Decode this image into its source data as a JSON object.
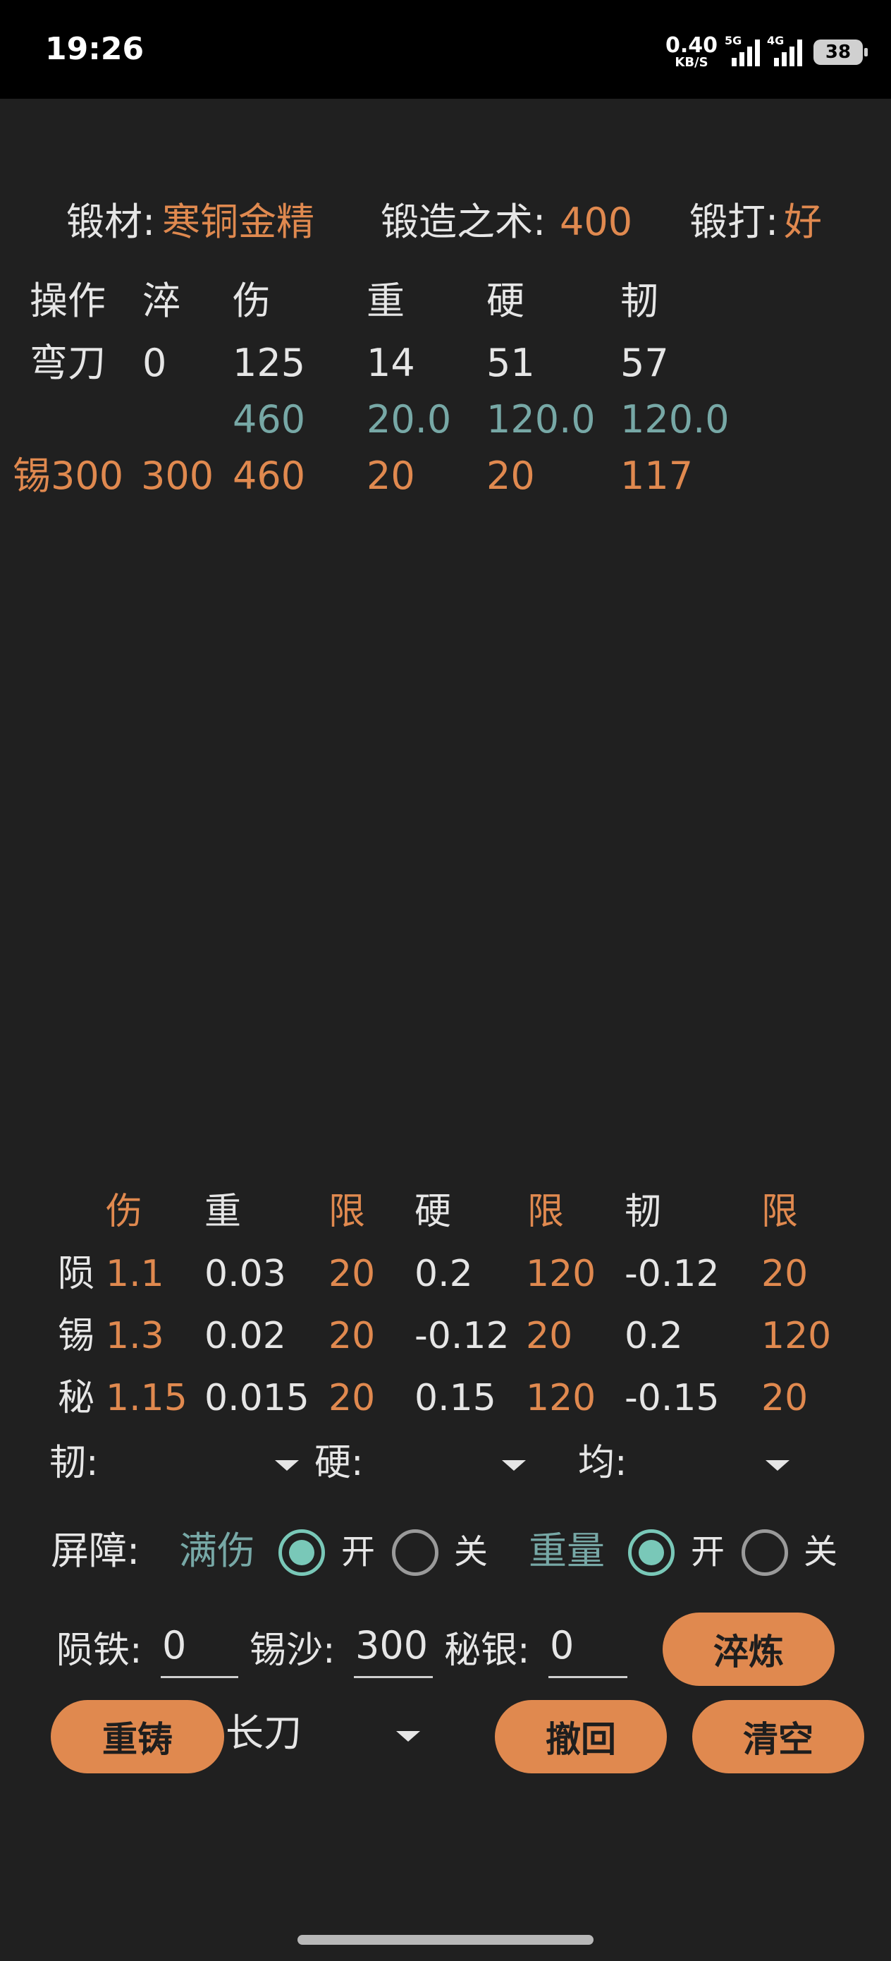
{
  "status_bar": {
    "time": "19:26",
    "net_speed": "0.40",
    "net_unit": "KB/S",
    "sim1": "5G",
    "sim2": "4G",
    "battery": "38"
  },
  "header": {
    "material_label": "锻材:",
    "material_value": "寒铜金精",
    "skill_label": "锻造之术:",
    "skill_value": "400",
    "forge_label": "锻打:",
    "forge_value": "好"
  },
  "log_table": {
    "columns": [
      "操作",
      "淬",
      "伤",
      "重",
      "硬",
      "韧"
    ],
    "row_weapon": [
      "弯刀",
      "0",
      "125",
      "14",
      "51",
      "57"
    ],
    "row_limits": [
      "460",
      "20.0",
      "120.0",
      "120.0"
    ],
    "row_op": [
      "锡300",
      "300",
      "460",
      "20",
      "20",
      "117"
    ]
  },
  "coef_table": {
    "headers": [
      "伤",
      "重",
      "限",
      "硬",
      "限",
      "韧",
      "限"
    ],
    "rows": [
      {
        "name": "陨",
        "values": [
          "1.1",
          "0.03",
          "20",
          "0.2",
          "120",
          "-0.12",
          "20"
        ]
      },
      {
        "name": "锡",
        "values": [
          "1.3",
          "0.02",
          "20",
          "-0.12",
          "20",
          "0.2",
          "120"
        ]
      },
      {
        "name": "秘",
        "values": [
          "1.15",
          "0.015",
          "20",
          "0.15",
          "120",
          "-0.15",
          "20"
        ]
      }
    ]
  },
  "dropdowns": {
    "toughness_label": "韧:",
    "hardness_label": "硬:",
    "balance_label": "均:"
  },
  "barrier": {
    "label": "屏障:",
    "full_damage_label": "满伤",
    "weight_label": "重量",
    "on_label": "开",
    "off_label": "关"
  },
  "inputs": {
    "meteor_label": "陨铁:",
    "meteor_value": "0",
    "tin_label": "锡沙:",
    "tin_value": "300",
    "silver_label": "秘银:",
    "silver_value": "0"
  },
  "buttons": {
    "quench": "淬炼",
    "recast": "重铸",
    "undo": "撤回",
    "clear": "清空"
  },
  "weapon_select": {
    "selected": "长刀"
  },
  "colors": {
    "accent": "#e0894f",
    "teal": "#77a8a6",
    "radio": "#79c8b8",
    "background": "#202020"
  }
}
